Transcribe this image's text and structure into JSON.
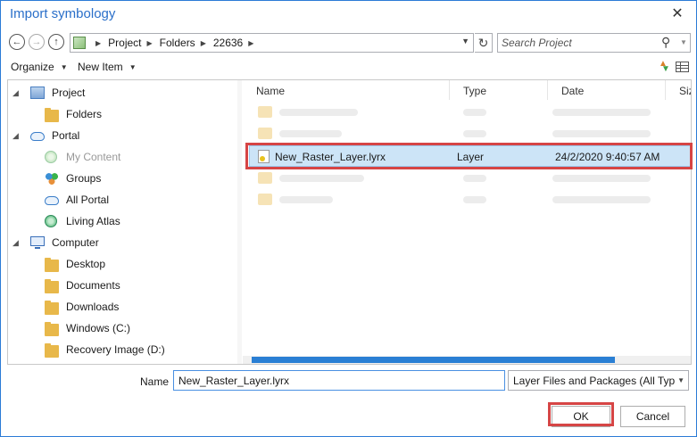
{
  "window": {
    "title": "Import symbology"
  },
  "nav": {
    "breadcrumbs": [
      "Project",
      "Folders",
      "22636"
    ],
    "search_placeholder": "Search Project"
  },
  "toolbar": {
    "organize_label": "Organize",
    "new_item_label": "New Item"
  },
  "tree": {
    "items": [
      {
        "label": "Project",
        "icon": "project-icon",
        "expanded": true,
        "level": 0
      },
      {
        "label": "Folders",
        "icon": "folder-icon",
        "level": 1
      },
      {
        "label": "Portal",
        "icon": "cloud-icon",
        "expanded": true,
        "level": 0
      },
      {
        "label": "My Content",
        "icon": "globe-icon",
        "level": 1,
        "dimmed": true
      },
      {
        "label": "Groups",
        "icon": "groups-icon",
        "level": 1
      },
      {
        "label": "All Portal",
        "icon": "cloud-icon",
        "level": 1
      },
      {
        "label": "Living Atlas",
        "icon": "living-atlas-icon",
        "level": 1
      },
      {
        "label": "Computer",
        "icon": "computer-icon",
        "expanded": true,
        "level": 0
      },
      {
        "label": "Desktop",
        "icon": "folder-icon",
        "level": 1
      },
      {
        "label": "Documents",
        "icon": "folder-icon",
        "level": 1
      },
      {
        "label": "Downloads",
        "icon": "folder-icon",
        "level": 1
      },
      {
        "label": "Windows (C:)",
        "icon": "drive-icon",
        "level": 1
      },
      {
        "label": "Recovery Image (D:)",
        "icon": "drive-icon",
        "level": 1
      }
    ]
  },
  "files": {
    "columns": [
      "Name",
      "Type",
      "Date",
      "Size"
    ],
    "selected_row": {
      "name": "New_Raster_Layer.lyrx",
      "type": "Layer",
      "date": "24/2/2020 9:40:57 AM"
    },
    "scroll_fraction": 0.81
  },
  "footer": {
    "name_label": "Name",
    "name_value": "New_Raster_Layer.lyrx",
    "file_type": "Layer Files and Packages (All Types)",
    "ok_label": "OK",
    "cancel_label": "Cancel"
  },
  "colors": {
    "accent": "#2a6fc9",
    "selection": "#cce4f7",
    "highlight_outline": "#d64545"
  }
}
